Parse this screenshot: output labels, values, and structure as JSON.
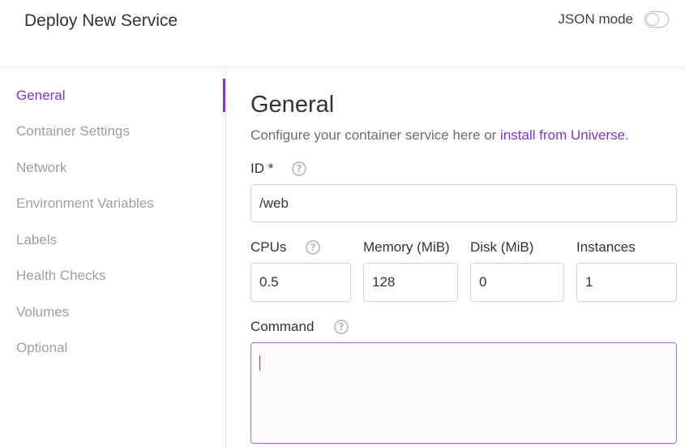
{
  "header": {
    "title": "Deploy New Service",
    "json_mode_label": "JSON mode",
    "json_mode_on": false
  },
  "sidebar": {
    "active": "General",
    "items": [
      {
        "label": "General"
      },
      {
        "label": "Container Settings"
      },
      {
        "label": "Network"
      },
      {
        "label": "Environment Variables"
      },
      {
        "label": "Labels"
      },
      {
        "label": "Health Checks"
      },
      {
        "label": "Volumes"
      },
      {
        "label": "Optional"
      }
    ]
  },
  "main": {
    "title": "General",
    "description": "Configure your container service here or ",
    "description_link": "install from Universe.",
    "id_label": "ID *",
    "id_value": "/web",
    "cpus_label": "CPUs",
    "cpus_value": "0.5",
    "memory_label": "Memory (MiB)",
    "memory_value": "128",
    "disk_label": "Disk (MiB)",
    "disk_value": "0",
    "instances_label": "Instances",
    "instances_value": "1",
    "command_label": "Command",
    "command_value": "",
    "help_glyph": "?"
  },
  "colors": {
    "accent": "#7f33de",
    "text": "#32323a",
    "muted": "#9e9ea3",
    "border": "#d5d5d9"
  },
  "icons": [
    "question-help-icon",
    "toggle-switch"
  ]
}
